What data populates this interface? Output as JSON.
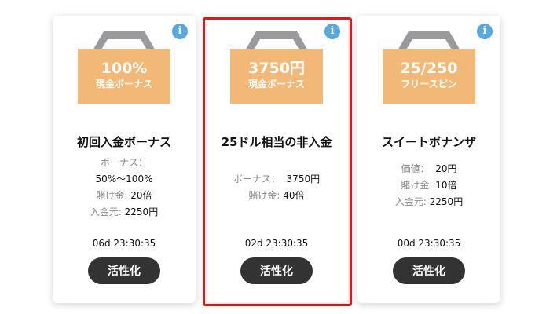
{
  "cards": [
    {
      "badge_value": "100%",
      "badge_label": "現金ボーナス",
      "title": "初回入金ボーナス",
      "details": [
        {
          "label": "ボーナス：",
          "value": ""
        },
        {
          "label": "",
          "value": "50%～100%"
        },
        {
          "label": "賭け金:",
          "value": "20倍"
        },
        {
          "label": "入金元:",
          "value": "2250円"
        }
      ],
      "timer": "06d  23:30:35",
      "button_label": "活性化"
    },
    {
      "badge_value": "3750円",
      "badge_label": "現金ボーナス",
      "title": "25ドル相当の非入金",
      "details": [
        {
          "label": "ボーナス：",
          "value": "3750円"
        },
        {
          "label": "賭け金:",
          "value": "40倍"
        }
      ],
      "timer": "02d  23:30:35",
      "button_label": "活性化",
      "selected": true
    },
    {
      "badge_value": "25/250",
      "badge_label": "フリースピン",
      "title": "スイートボナンザ",
      "details": [
        {
          "label": "価値：",
          "value": "20円"
        },
        {
          "label": "賭け金:",
          "value": "10倍"
        },
        {
          "label": "入金元:",
          "value": "2250円"
        }
      ],
      "timer": "00d  23:30:35",
      "button_label": "活性化"
    }
  ],
  "colors": {
    "badge": "#f1b877",
    "hexagon": "#9a9a9a",
    "info_icon": "#5aa7dc",
    "button": "#333333",
    "selection_outline": "#e4141d"
  },
  "icons": {
    "info": "i"
  }
}
